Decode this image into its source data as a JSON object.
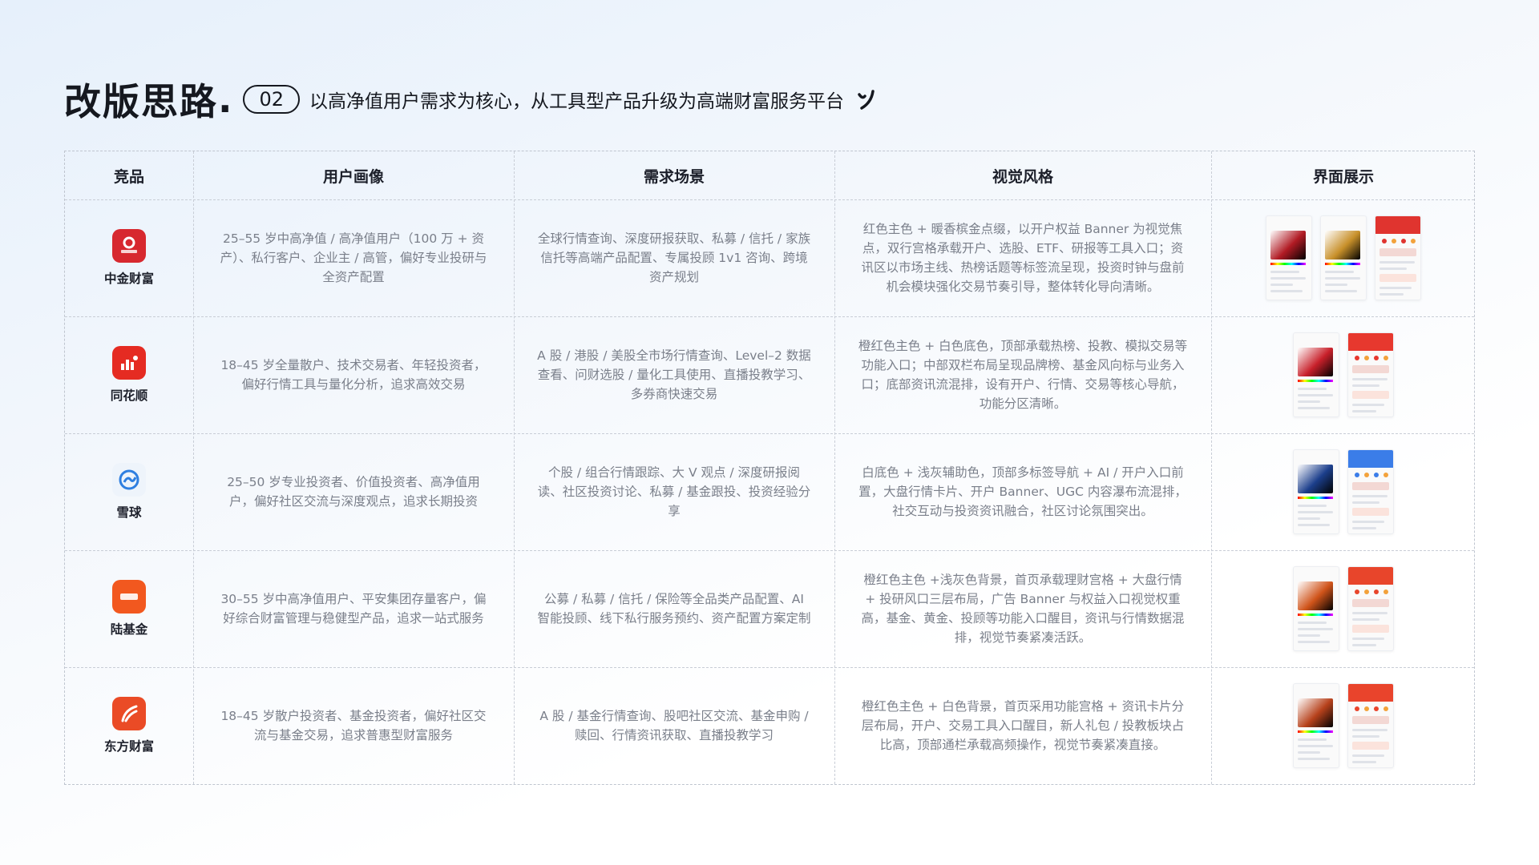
{
  "header": {
    "title": "改版思路",
    "dot": ".",
    "badge": "02",
    "subtitle": "以高净值用户需求为核心，从工具型产品升级为高端财富服务平台",
    "deco_icon": "brush-stroke-icon"
  },
  "table": {
    "columns": [
      "竞品",
      "用户画像",
      "需求场景",
      "视觉风格",
      "界面展示"
    ],
    "rows": [
      {
        "brand": "中金财富",
        "logo_color": "#d7282f",
        "logo_icon": "cicc-wealth-logo",
        "logo_text": "中金财富",
        "user": "25–55 岁中高净值 / 高净值用户（100 万 + 资产）、私行客户、企业主 / 高管，偏好专业投研与全资产配置",
        "scene": "全球行情查询、深度研报获取、私募 / 信托 / 家族信托等高端产品配置、专属投顾 1v1 咨询、跨境资产规划",
        "visual": "红色主色 + 暖香槟金点缀，以开户权益 Banner 为视觉焦点，双行宫格承载开户、选股、ETF、研报等工具入口；资讯区以市场主线、热榜话题等标签流呈现，投资时钟与盘前机会模块强化交易节奏引导，整体转化导向清晰。",
        "gradients": [
          "#b11b24",
          "#c8902a"
        ],
        "app_color": "#e0342f",
        "show_three": true
      },
      {
        "brand": "同花顺",
        "logo_color": "#e52b22",
        "logo_icon": "tonghuashun-logo",
        "user": "18–45 岁全量散户、技术交易者、年轻投资者，偏好行情工具与量化分析，追求高效交易",
        "scene": "A 股 / 港股 / 美股全市场行情查询、Level–2 数据查看、问财选股 / 量化工具使用、直播投教学习、多券商快速交易",
        "visual": "橙红色主色 + 白色底色，顶部承载热榜、投教、模拟交易等功能入口；中部双栏布局呈现品牌榜、基金风向标与业务入口；底部资讯流混排，设有开户、行情、交易等核心导航，功能分区清晰。",
        "gradients": [
          "#c8202a"
        ],
        "app_color": "#e7382e",
        "show_three": false
      },
      {
        "brand": "雪球",
        "logo_color": "#eef4fb",
        "logo_icon": "xueqiu-logo",
        "user": "25–50 岁专业投资者、价值投资者、高净值用户，偏好社区交流与深度观点，追求长期投资",
        "scene": "个股 / 组合行情跟踪、大 V 观点 / 深度研报阅读、社区投资讨论、私募 / 基金跟投、投资经验分享",
        "visual": "白底色 + 浅灰辅助色，顶部多标签导航 + AI / 开户入口前置，大盘行情卡片、开户 Banner、UGC 内容瀑布流混排，社交互动与投资资讯融合，社区讨论氛围突出。",
        "gradients": [
          "#1c3f8c"
        ],
        "app_color": "#3b7de8",
        "show_three": false
      },
      {
        "brand": "陆基金",
        "logo_color": "#f2581f",
        "logo_icon": "lufund-logo",
        "logo_text": "陆基金",
        "user": "30–55 岁中高净值用户、平安集团存量客户，偏好综合财富管理与稳健型产品，追求一站式服务",
        "scene": "公募 / 私募 / 信托 / 保险等全品类产品配置、AI 智能投顾、线下私行服务预约、资产配置方案定制",
        "visual": "橙红色主色 +浅灰色背景，首页承载理财宫格 + 大盘行情 + 投研风口三层布局，广告 Banner 与权益入口视觉权重高，基金、黄金、投顾等功能入口醒目，资讯与行情数据混排，视觉节奏紧凑活跃。",
        "gradients": [
          "#d0541a"
        ],
        "app_color": "#e8452b",
        "show_three": false
      },
      {
        "brand": "东方财富",
        "logo_color": "#ea4b26",
        "logo_icon": "eastmoney-logo",
        "user": "18–45 岁散户投资者、基金投资者，偏好社区交流与基金交易，追求普惠型财富服务",
        "scene": "A 股 / 基金行情查询、股吧社区交流、基金申购 / 赎回、行情资讯获取、直播投教学习",
        "visual": "橙红色主色 + 白色背景，首页采用功能宫格 + 资讯卡片分层布局，开户、交易工具入口醒目，新人礼包 / 投教板块占比高，顶部通栏承载高频操作，视觉节奏紧凑直接。",
        "gradients": [
          "#b7421c"
        ],
        "app_color": "#e9442c",
        "show_three": false
      }
    ]
  }
}
